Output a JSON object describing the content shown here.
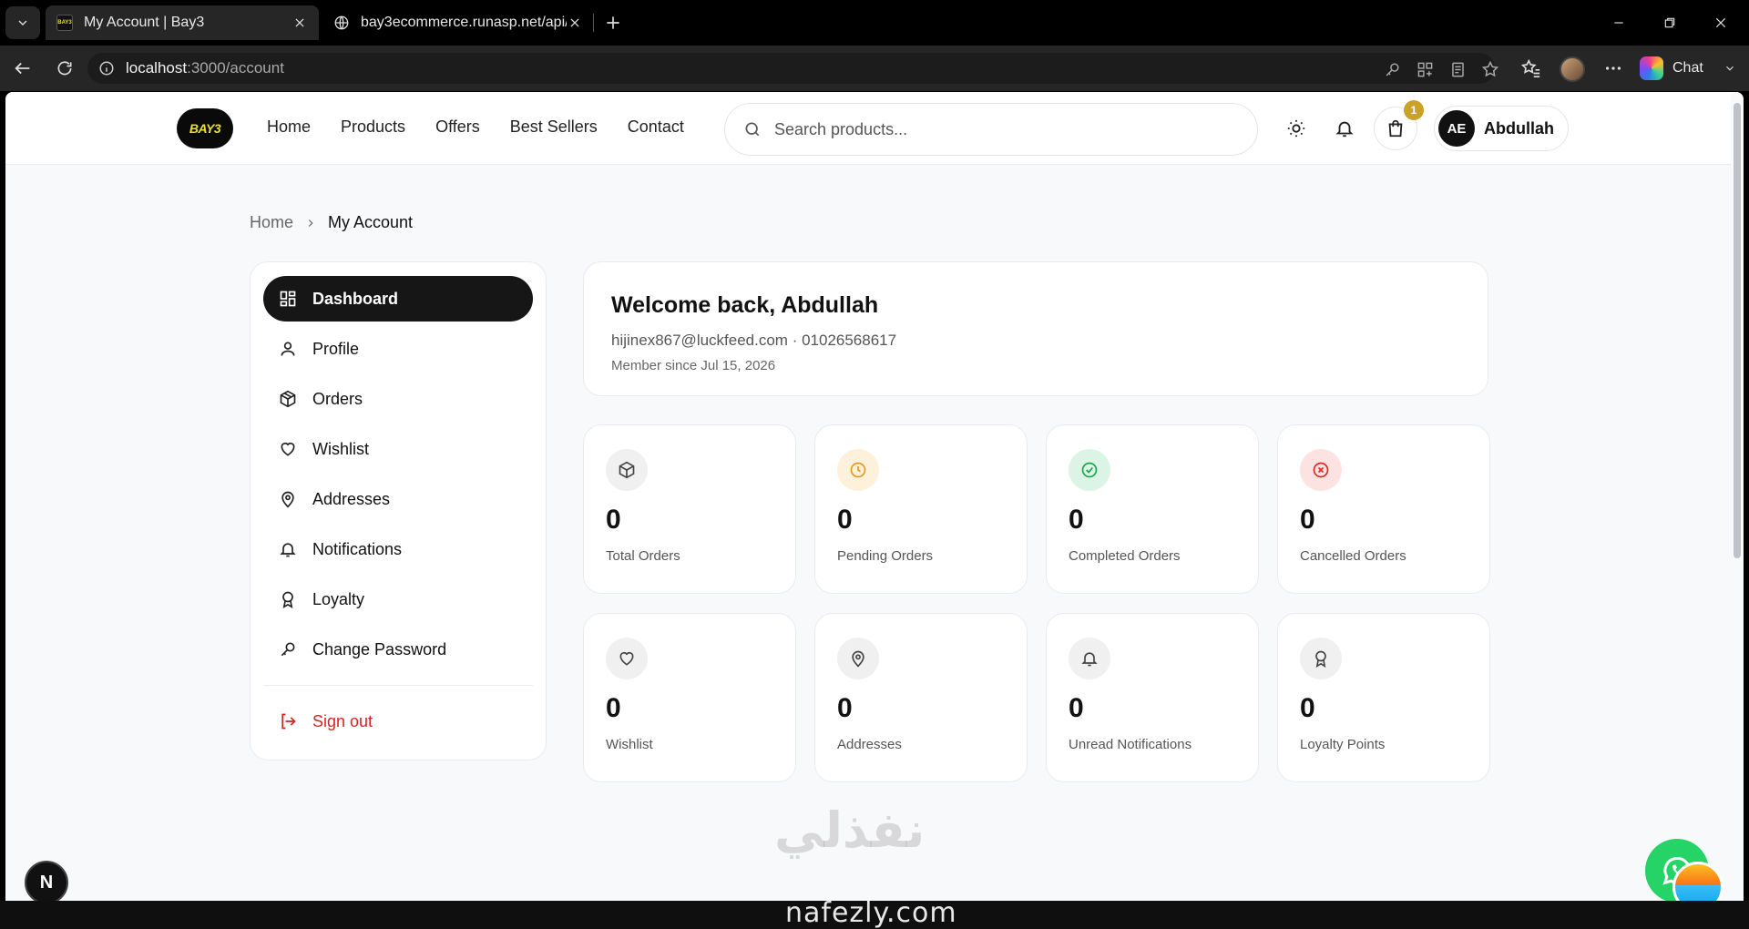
{
  "browser": {
    "tabs": [
      {
        "title": "My Account | Bay3",
        "favicon_text": "BAY3",
        "active": true
      },
      {
        "title": "bay3ecommerce.runasp.net/api/au",
        "active": false
      }
    ],
    "url_host": "localhost",
    "url_rest": ":3000/account",
    "chat_label": "Chat"
  },
  "header": {
    "logo_text": "BAY3",
    "nav": [
      "Home",
      "Products",
      "Offers",
      "Best Sellers",
      "Contact"
    ],
    "search_placeholder": "Search products...",
    "cart_count": "1",
    "user_initials": "AE",
    "user_name": "Abdullah"
  },
  "breadcrumb": {
    "home": "Home",
    "current": "My Account"
  },
  "sidebar": {
    "items": [
      {
        "label": "Dashboard",
        "icon": "dashboard-icon",
        "active": true
      },
      {
        "label": "Profile",
        "icon": "user-icon"
      },
      {
        "label": "Orders",
        "icon": "box-icon"
      },
      {
        "label": "Wishlist",
        "icon": "heart-icon"
      },
      {
        "label": "Addresses",
        "icon": "map-pin-icon"
      },
      {
        "label": "Notifications",
        "icon": "bell-icon"
      },
      {
        "label": "Loyalty",
        "icon": "award-icon"
      },
      {
        "label": "Change Password",
        "icon": "key-icon"
      }
    ],
    "signout": "Sign out"
  },
  "welcome": {
    "title": "Welcome back, Abdullah",
    "contact": "hijinex867@luckfeed.com · 01026568617",
    "since": "Member since Jul 15, 2026"
  },
  "stats": [
    {
      "value": "0",
      "label": "Total Orders",
      "icon": "box-icon",
      "color": "#444444",
      "bg": "#f0f0f0"
    },
    {
      "value": "0",
      "label": "Pending Orders",
      "icon": "clock-icon",
      "color": "#e8961b",
      "bg": "#fdf1dc"
    },
    {
      "value": "0",
      "label": "Completed Orders",
      "icon": "check-circle-icon",
      "color": "#16a34a",
      "bg": "#dcf4e6"
    },
    {
      "value": "0",
      "label": "Cancelled Orders",
      "icon": "x-circle-icon",
      "color": "#e02424",
      "bg": "#fde2e2"
    },
    {
      "value": "0",
      "label": "Wishlist",
      "icon": "heart-icon",
      "color": "#444444",
      "bg": "#f0f0f0"
    },
    {
      "value": "0",
      "label": "Addresses",
      "icon": "map-pin-icon",
      "color": "#444444",
      "bg": "#f0f0f0"
    },
    {
      "value": "0",
      "label": "Unread Notifications",
      "icon": "bell-icon",
      "color": "#444444",
      "bg": "#f0f0f0"
    },
    {
      "value": "0",
      "label": "Loyalty Points",
      "icon": "award-icon",
      "color": "#444444",
      "bg": "#f0f0f0"
    }
  ],
  "overlay": {
    "next_badge": "N",
    "watermark_ar": "نفذلي",
    "watermark_en": "nafezly.com"
  }
}
